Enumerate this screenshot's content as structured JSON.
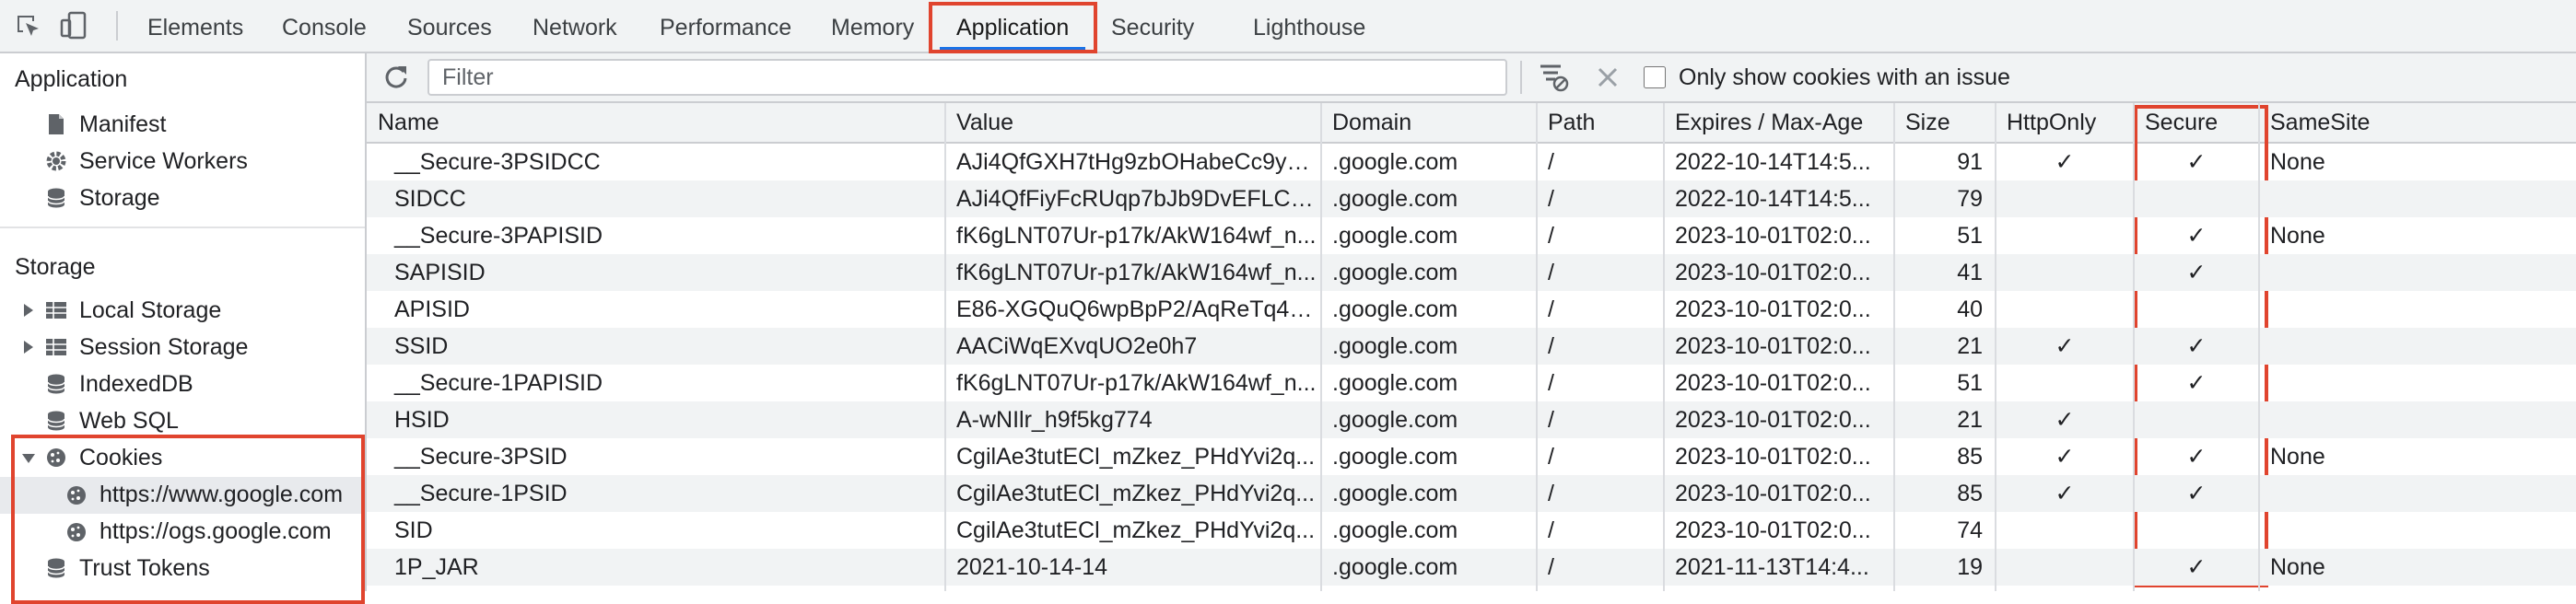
{
  "tabs": [
    "Elements",
    "Console",
    "Sources",
    "Network",
    "Performance",
    "Memory",
    "Application",
    "Security",
    "Lighthouse"
  ],
  "active_tab": "Application",
  "sidebar": {
    "application_header": "Application",
    "application_items": [
      "Manifest",
      "Service Workers",
      "Storage"
    ],
    "storage_header": "Storage",
    "storage_items": [
      "Local Storage",
      "Session Storage",
      "IndexedDB",
      "Web SQL",
      "Cookies",
      "Trust Tokens"
    ],
    "cookie_origins": [
      "https://www.google.com",
      "https://ogs.google.com"
    ],
    "selected_origin": "https://www.google.com"
  },
  "toolbar": {
    "filter_placeholder": "Filter",
    "only_issues_label": "Only show cookies with an issue",
    "only_issues_checked": false
  },
  "table": {
    "columns": [
      "Name",
      "Value",
      "Domain",
      "Path",
      "Expires / Max-Age",
      "Size",
      "HttpOnly",
      "Secure",
      "SameSite"
    ],
    "rows": [
      {
        "name": "__Secure-3PSIDCC",
        "value": "AJi4QfGXH7tHg9zbOHabeCc9yQ...",
        "domain": ".google.com",
        "path": "/",
        "expires": "2022-10-14T14:5...",
        "size": "91",
        "httponly": "✓",
        "secure": "✓",
        "samesite": "None"
      },
      {
        "name": "SIDCC",
        "value": "AJi4QfFiyFcRUqp7bJb9DvEFLC0...",
        "domain": ".google.com",
        "path": "/",
        "expires": "2022-10-14T14:5...",
        "size": "79",
        "httponly": "",
        "secure": "",
        "samesite": ""
      },
      {
        "name": "__Secure-3PAPISID",
        "value": "fK6gLNT07Ur-p17k/AkW164wf_n...",
        "domain": ".google.com",
        "path": "/",
        "expires": "2023-10-01T02:0...",
        "size": "51",
        "httponly": "",
        "secure": "✓",
        "samesite": "None"
      },
      {
        "name": "SAPISID",
        "value": "fK6gLNT07Ur-p17k/AkW164wf_n...",
        "domain": ".google.com",
        "path": "/",
        "expires": "2023-10-01T02:0...",
        "size": "41",
        "httponly": "",
        "secure": "✓",
        "samesite": ""
      },
      {
        "name": "APISID",
        "value": "E86-XGQuQ6wpBpP2/AqReTq45...",
        "domain": ".google.com",
        "path": "/",
        "expires": "2023-10-01T02:0...",
        "size": "40",
        "httponly": "",
        "secure": "",
        "samesite": ""
      },
      {
        "name": "SSID",
        "value": "AACiWqEXvqUO2e0h7",
        "domain": ".google.com",
        "path": "/",
        "expires": "2023-10-01T02:0...",
        "size": "21",
        "httponly": "✓",
        "secure": "✓",
        "samesite": ""
      },
      {
        "name": "__Secure-1PAPISID",
        "value": "fK6gLNT07Ur-p17k/AkW164wf_n...",
        "domain": ".google.com",
        "path": "/",
        "expires": "2023-10-01T02:0...",
        "size": "51",
        "httponly": "",
        "secure": "✓",
        "samesite": ""
      },
      {
        "name": "HSID",
        "value": "A-wNIlr_h9f5kg774",
        "domain": ".google.com",
        "path": "/",
        "expires": "2023-10-01T02:0...",
        "size": "21",
        "httponly": "✓",
        "secure": "",
        "samesite": ""
      },
      {
        "name": "__Secure-3PSID",
        "value": "CgilAe3tutECl_mZkez_PHdYvi2q...",
        "domain": ".google.com",
        "path": "/",
        "expires": "2023-10-01T02:0...",
        "size": "85",
        "httponly": "✓",
        "secure": "✓",
        "samesite": "None"
      },
      {
        "name": "__Secure-1PSID",
        "value": "CgilAe3tutECl_mZkez_PHdYvi2q...",
        "domain": ".google.com",
        "path": "/",
        "expires": "2023-10-01T02:0...",
        "size": "85",
        "httponly": "✓",
        "secure": "✓",
        "samesite": ""
      },
      {
        "name": "SID",
        "value": "CgilAe3tutECl_mZkez_PHdYvi2q...",
        "domain": ".google.com",
        "path": "/",
        "expires": "2023-10-01T02:0...",
        "size": "74",
        "httponly": "",
        "secure": "",
        "samesite": ""
      },
      {
        "name": "1P_JAR",
        "value": "2021-10-14-14",
        "domain": ".google.com",
        "path": "/",
        "expires": "2021-11-13T14:4...",
        "size": "19",
        "httponly": "",
        "secure": "✓",
        "samesite": "None"
      }
    ]
  },
  "colors": {
    "highlight": "#e0442e",
    "active_tab_underline": "#1a73e8",
    "toolbar_bg": "#f1f3f4"
  }
}
